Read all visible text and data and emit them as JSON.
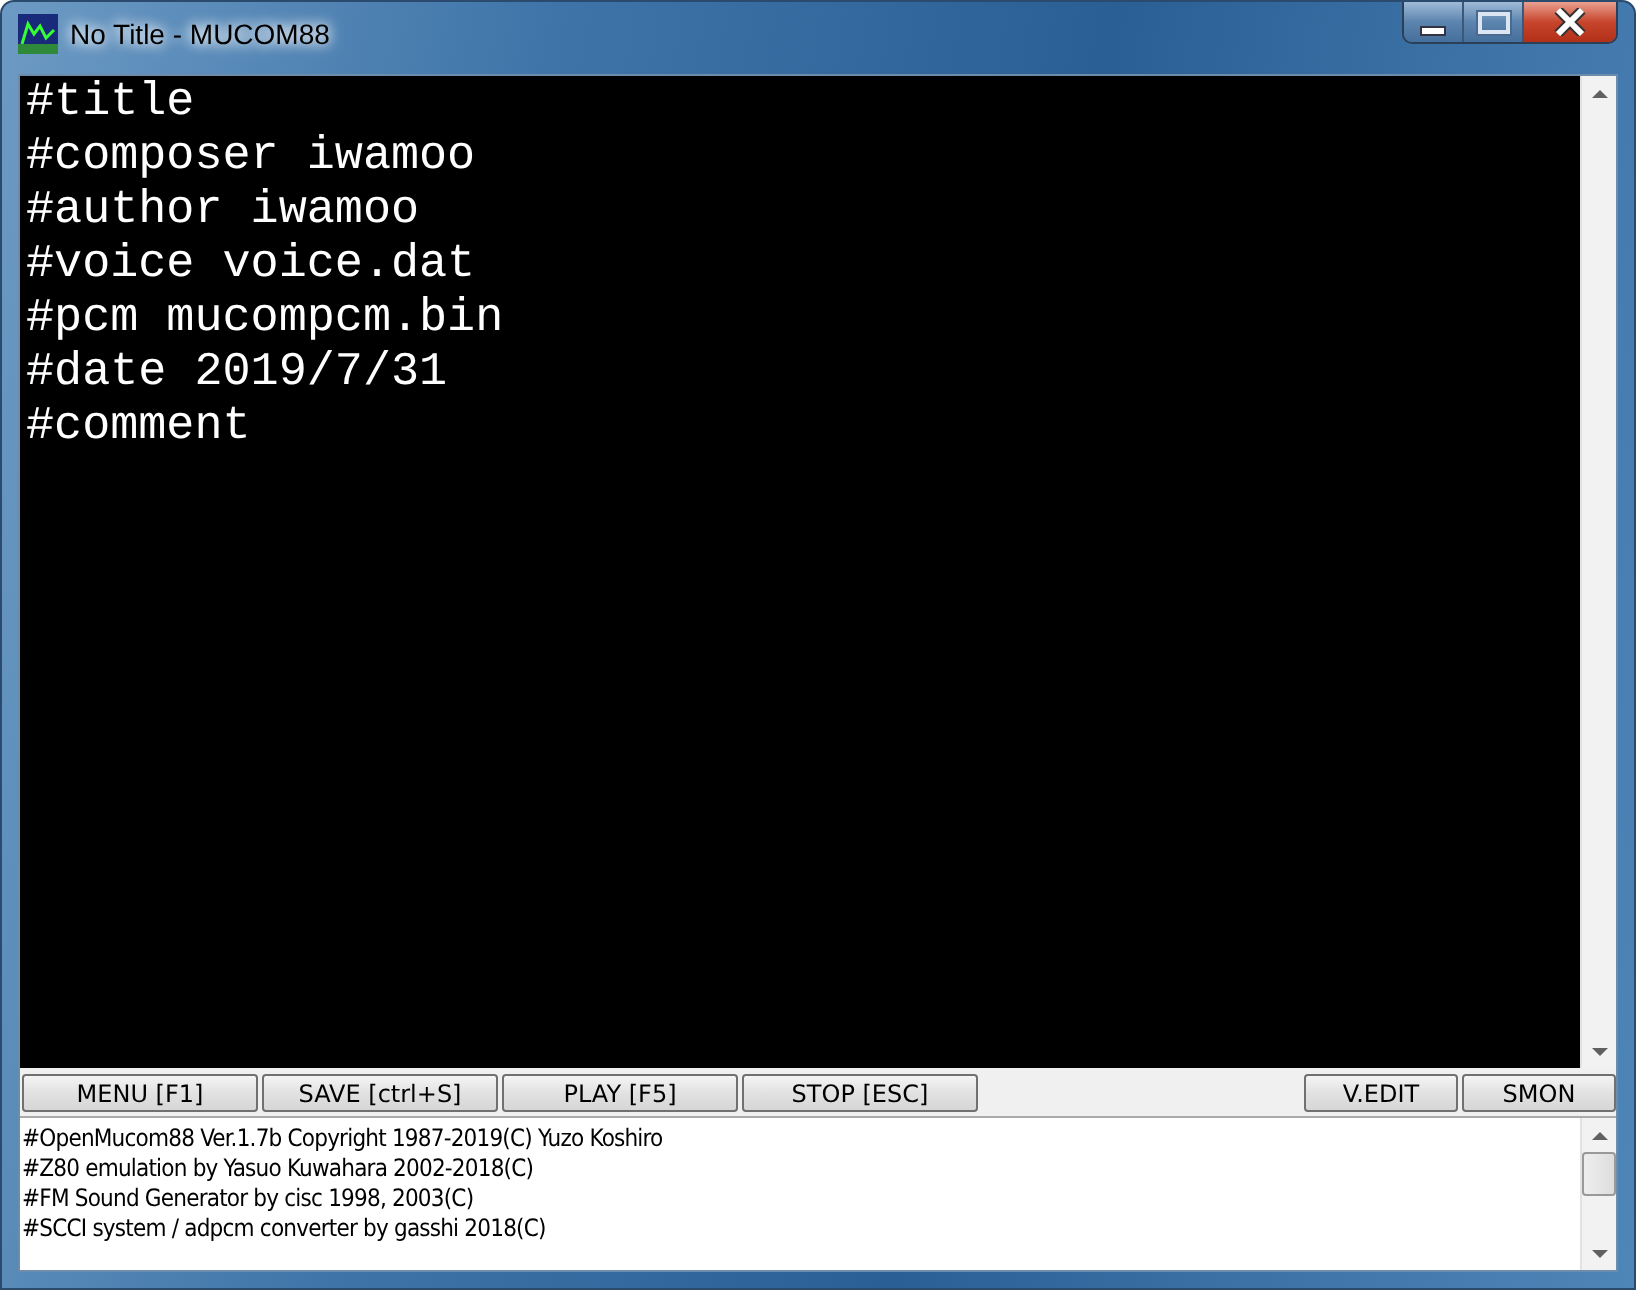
{
  "window": {
    "title": "No Title - MUCOM88"
  },
  "editor": {
    "lines": [
      "#title",
      "#composer iwamoo",
      "#author iwamoo",
      "#voice voice.dat",
      "#pcm mucompcm.bin",
      "#date 2019/7/31",
      "#comment"
    ]
  },
  "toolbar": {
    "left_buttons": [
      "MENU [F1]",
      "SAVE [ctrl+S]",
      "PLAY [F5]",
      "STOP [ESC]"
    ],
    "right_buttons": [
      "V.EDIT",
      "SMON"
    ]
  },
  "log": {
    "lines": [
      "#OpenMucom88 Ver.1.7b Copyright 1987-2019(C) Yuzo Koshiro",
      "#Z80 emulation by Yasuo Kuwahara 2002-2018(C)",
      "#FM Sound Generator by cisc 1998, 2003(C)",
      "#SCCI system / adpcm converter by gasshi 2018(C)"
    ]
  }
}
